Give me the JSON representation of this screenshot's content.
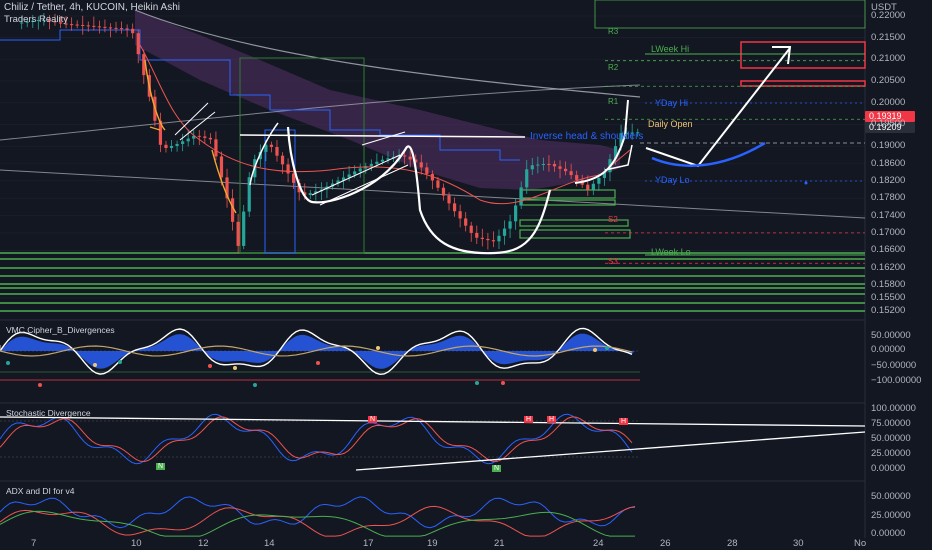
{
  "header": {
    "symbol": "Chiliz / Tether, 4h, KUCOIN, Heikin Ashi",
    "indicator": "Traders Reality"
  },
  "axis": {
    "currency": "USDT",
    "price_ticks": [
      "0.22000",
      "0.21500",
      "0.21000",
      "0.20500",
      "0.20000",
      "0.19500",
      "0.19000",
      "0.18600",
      "0.18200",
      "0.17800",
      "0.17400",
      "0.17000",
      "0.16600",
      "0.16200",
      "0.15800",
      "0.15500",
      "0.15200"
    ],
    "x_ticks": [
      "7",
      "10",
      "12",
      "14",
      "17",
      "19",
      "21",
      "24",
      "26",
      "28",
      "30",
      "No"
    ]
  },
  "price_tags": {
    "current": "0.19319",
    "second": "0.19209",
    "current_color": "#f23645",
    "second_color": "#2a2e39"
  },
  "levels": {
    "lweek_hi": "LWeek Hi",
    "lweek_lo": "LWeek Lo",
    "yday_hi": "YDay Hi",
    "yday_lo": "YDay Lo",
    "daily_open": "Daily Open",
    "r1": "R1",
    "r2": "R2",
    "r3": "R3",
    "s2": "S2",
    "s3": "S3"
  },
  "annotations": {
    "pattern": "Inverse head & shoulders"
  },
  "panes": {
    "vmc": {
      "title": "VMC Cipher_B_Divergences",
      "ticks": [
        "50.00000",
        "0.00000",
        "−50.00000",
        "−100.00000"
      ]
    },
    "stoch": {
      "title": "Stochastic Divergence",
      "ticks": [
        "100.00000",
        "75.00000",
        "50.00000",
        "25.00000",
        "0.00000"
      ],
      "markers": [
        "N",
        "N",
        "N",
        "H",
        "H",
        "H"
      ]
    },
    "adx": {
      "title": "ADX and DI for v4",
      "ticks": [
        "50.00000",
        "25.00000",
        "0.00000"
      ]
    }
  },
  "colors": {
    "background": "#131722",
    "bull": "#26a69a",
    "bear": "#ef5350",
    "green_box": "#4caf50",
    "red_box": "#f23645",
    "cloud": "#7b3f8c",
    "blue_line": "#2962ff"
  },
  "chart_data": {
    "type": "candlestick",
    "title": "Chiliz / Tether, 4h, KUCOIN, Heikin Ashi",
    "y_unit": "USDT",
    "ylim": [
      0.151,
      0.2215
    ],
    "x_range_days": [
      6.5,
      31.2
    ],
    "price_series_hint": [
      {
        "day": 6.6,
        "price": 0.2185
      },
      {
        "day": 7.2,
        "price": 0.2192
      },
      {
        "day": 7.8,
        "price": 0.2182
      },
      {
        "day": 8.5,
        "price": 0.2178
      },
      {
        "day": 9.2,
        "price": 0.2173
      },
      {
        "day": 9.9,
        "price": 0.217
      },
      {
        "day": 10.4,
        "price": 0.2025
      },
      {
        "day": 10.8,
        "price": 0.1892
      },
      {
        "day": 11.3,
        "price": 0.1906
      },
      {
        "day": 11.8,
        "price": 0.1925
      },
      {
        "day": 12.3,
        "price": 0.1915
      },
      {
        "day": 12.8,
        "price": 0.177
      },
      {
        "day": 13.1,
        "price": 0.167
      },
      {
        "day": 13.5,
        "price": 0.186
      },
      {
        "day": 14.0,
        "price": 0.191
      },
      {
        "day": 14.5,
        "price": 0.185
      },
      {
        "day": 15.0,
        "price": 0.1785
      },
      {
        "day": 15.6,
        "price": 0.18
      },
      {
        "day": 16.2,
        "price": 0.1825
      },
      {
        "day": 16.8,
        "price": 0.185
      },
      {
        "day": 17.4,
        "price": 0.1868
      },
      {
        "day": 18.0,
        "price": 0.188
      },
      {
        "day": 18.5,
        "price": 0.186
      },
      {
        "day": 19.0,
        "price": 0.1815
      },
      {
        "day": 19.6,
        "price": 0.175
      },
      {
        "day": 20.2,
        "price": 0.169
      },
      {
        "day": 20.8,
        "price": 0.168
      },
      {
        "day": 21.3,
        "price": 0.173
      },
      {
        "day": 21.8,
        "price": 0.1855
      },
      {
        "day": 22.4,
        "price": 0.186
      },
      {
        "day": 23.0,
        "price": 0.184
      },
      {
        "day": 23.6,
        "price": 0.18
      },
      {
        "day": 24.1,
        "price": 0.184
      },
      {
        "day": 24.6,
        "price": 0.193
      },
      {
        "day": 25.1,
        "price": 0.1932
      }
    ]
  }
}
